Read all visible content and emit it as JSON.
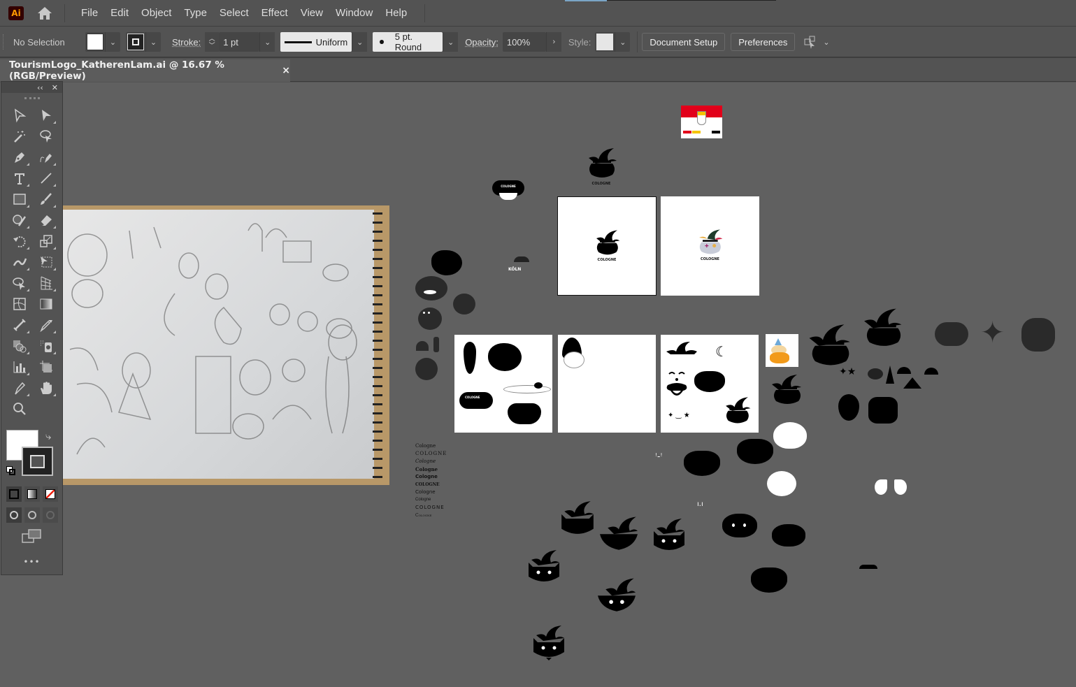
{
  "app": {
    "logo": "Ai",
    "home_icon": "home-icon"
  },
  "menu": [
    "File",
    "Edit",
    "Object",
    "Type",
    "Select",
    "Effect",
    "View",
    "Window",
    "Help"
  ],
  "control_bar": {
    "selection": "No Selection",
    "stroke_label": "Stroke:",
    "stroke_value": "1 pt",
    "profile": "Uniform",
    "brush": "5 pt. Round",
    "opacity_label": "Opacity:",
    "opacity_value": "100%",
    "style_label": "Style:",
    "document_setup": "Document Setup",
    "preferences": "Preferences"
  },
  "document_tab": {
    "title": "TourismLogo_KatherenLam.ai @ 16.67 % (RGB/Preview)",
    "close": "×"
  },
  "toolbar": {
    "collapse": "‹‹",
    "close": "✕",
    "more": "•••",
    "tools": [
      "selection",
      "direct-selection",
      "magic-wand",
      "lasso",
      "pen",
      "curvature",
      "type",
      "line-segment",
      "rectangle",
      "paintbrush",
      "shaper",
      "eraser",
      "rotate",
      "scale",
      "width",
      "free-transform",
      "shape-builder",
      "perspective-grid",
      "mesh",
      "gradient",
      "blend",
      "eyedropper",
      "symbol-sprayer",
      "live-paint",
      "column-graph",
      "artboard",
      "slice",
      "hand",
      "zoom"
    ]
  },
  "canvas": {
    "logo_label": "COLOGNE",
    "koln_label": "KÖLN",
    "font_samples": [
      "Cologne",
      "COLOGNE",
      "Cologne",
      "Cologne",
      "Cologne",
      "COLOGNE",
      "Cologne",
      "Cologne",
      "COLOGNE",
      "Cologne"
    ],
    "flag_colors": [
      "#e2001a",
      "#ffffff",
      "#f5c400",
      "#000000"
    ]
  }
}
